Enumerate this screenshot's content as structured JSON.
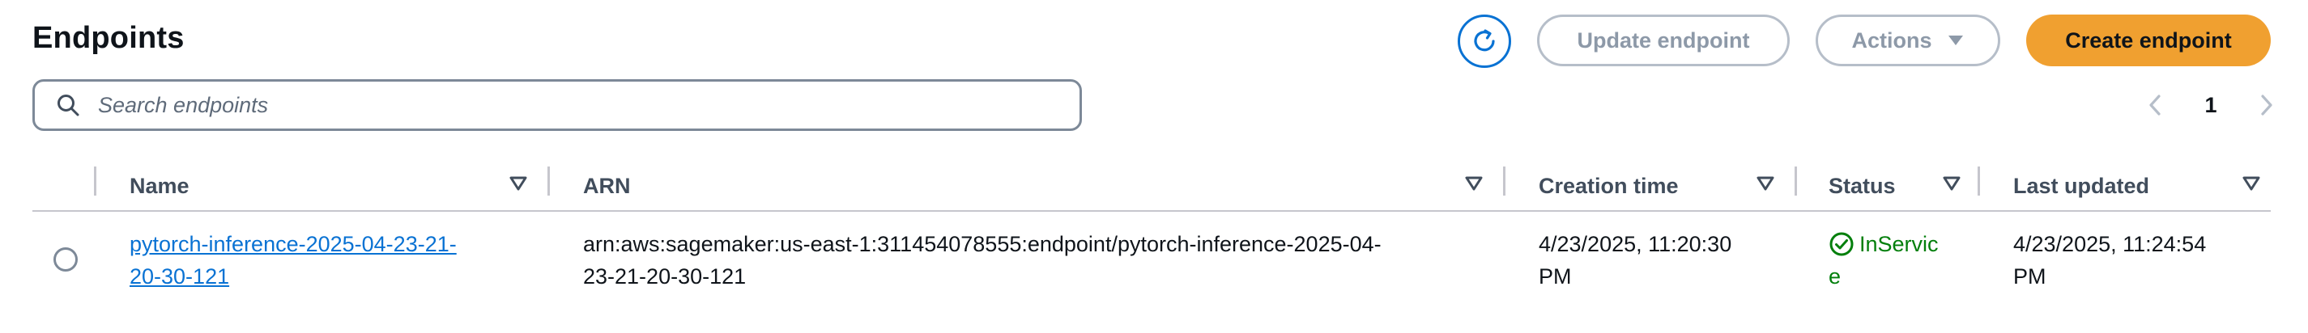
{
  "page": {
    "title": "Endpoints"
  },
  "header_actions": {
    "update_label": "Update endpoint",
    "actions_label": "Actions",
    "create_label": "Create endpoint"
  },
  "search": {
    "placeholder": "Search endpoints",
    "value": ""
  },
  "pagination": {
    "current_page": "1"
  },
  "table": {
    "columns": [
      "Name",
      "ARN",
      "Creation time",
      "Status",
      "Last updated"
    ],
    "rows": [
      {
        "name_line1": "pytorch-inference-2025-04-23-21-",
        "name_line2": "20-30-121",
        "arn_line1": "arn:aws:sagemaker:us-east-1:311454078555:endpoint/pytorch-inference-2025-04-",
        "arn_line2": "23-21-20-30-121",
        "creation_line1": "4/23/2025, 11:20:30",
        "creation_line2": "PM",
        "status_line1": "InServic",
        "status_line2": "e",
        "updated_line1": "4/23/2025, 11:24:54",
        "updated_line2": "PM"
      }
    ]
  },
  "colors": {
    "primary_button": "#f0a030",
    "link": "#0972d3",
    "status_success": "#037f0c",
    "disabled": "#8d99a8"
  },
  "icons": {
    "refresh": "refresh-icon",
    "search": "search-icon",
    "caret": "caret-down-icon",
    "sort": "sort-icon",
    "status": "status-success-icon"
  }
}
